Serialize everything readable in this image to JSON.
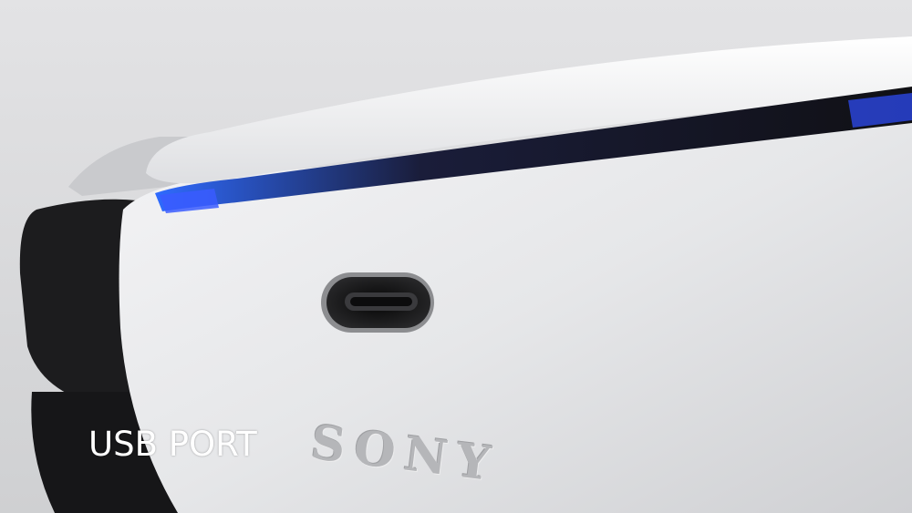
{
  "caption": {
    "text": "USB PORT"
  },
  "logo": {
    "text": "SONY"
  },
  "colors": {
    "background": "#d9dadc",
    "shell": "#e8e9eb",
    "light_bar": "#2f4fff",
    "trigger": "#1c1c1e",
    "port": "#111111"
  }
}
